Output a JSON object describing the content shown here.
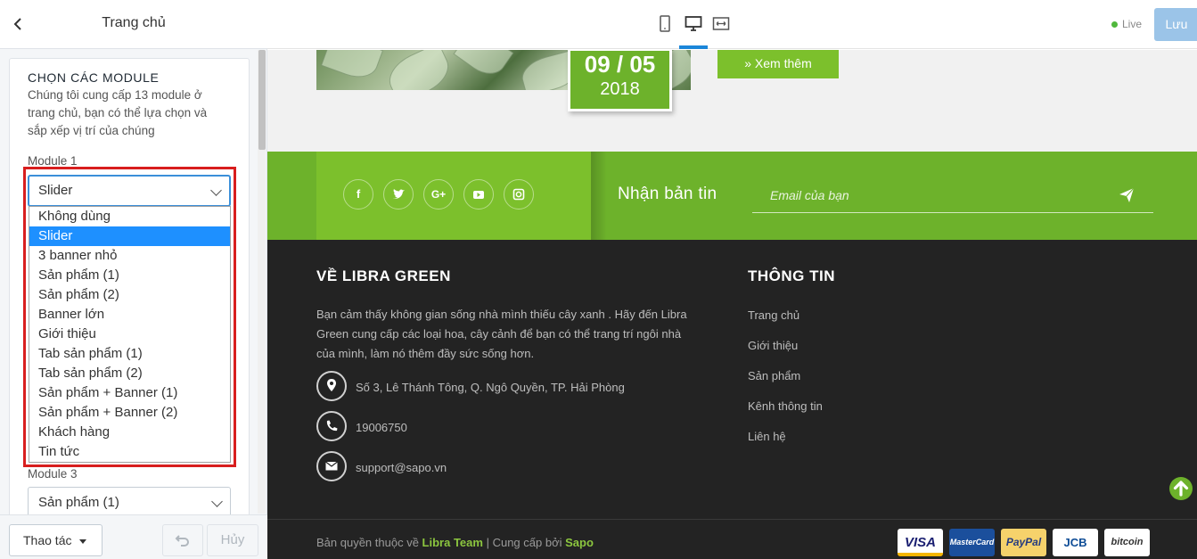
{
  "left_panel": {
    "title": "Trang chủ",
    "section_title": "CHỌN CÁC MODULE",
    "section_desc": "Chúng tôi cung cấp 13 module ở trang chủ, bạn có thể lựa chọn và sắp xếp vị trí của chúng",
    "module1_label": "Module 1",
    "module1_value": "Slider",
    "dropdown_options": [
      "Không dùng",
      "Slider",
      "3 banner nhỏ",
      "Sản phẩm (1)",
      "Sản phẩm (2)",
      "Banner lớn",
      "Giới thiệu",
      "Tab sản phẩm (1)",
      "Tab sản phẩm (2)",
      "Sản phẩm + Banner (1)",
      "Sản phẩm + Banner (2)",
      "Khách hàng",
      "Tin tức"
    ],
    "dropdown_selected": "Slider",
    "module3_label": "Module 3",
    "module3_value": "Sản phẩm (1)",
    "action_button": "Thao tác",
    "cancel_button": "Hủy"
  },
  "topbar": {
    "live_label": "Live",
    "save_button": "Lưu",
    "active_device": "desktop"
  },
  "preview": {
    "date_day": "09 / 05",
    "date_year": "2018",
    "more_button": "» Xem thêm",
    "social_icons": [
      "facebook-icon",
      "twitter-icon",
      "google-plus-icon",
      "youtube-icon",
      "instagram-icon"
    ],
    "newsletter_title": "Nhận bản tin",
    "email_placeholder": "Email của bạn",
    "about_title": "VỀ LIBRA GREEN",
    "about_text": "Bạn cảm thấy không gian sống nhà mình thiếu cây xanh . Hãy đến Libra Green cung cấp các loại hoa, cây cảnh để bạn có thể trang trí ngôi nhà của mình, làm nó thêm đầy sức sống hơn.",
    "address": "Số 3, Lê Thánh Tông, Q. Ngô Quyền, TP. Hải Phòng",
    "phone": "19006750",
    "email": "support@sapo.vn",
    "info_title": "THÔNG TIN",
    "info_links": [
      "Trang chủ",
      "Giới thiệu",
      "Sản phẩm",
      "Kênh thông tin",
      "Liên hệ"
    ],
    "copyright_prefix": "Bản quyền thuộc về",
    "copyright_team": "Libra Team",
    "copyright_sep": "|",
    "copyright_provider_prefix": "Cung cấp bởi",
    "copyright_provider": "Sapo",
    "payment_methods": [
      "VISA",
      "MasterCard",
      "PayPal",
      "JCB",
      "bitcoin"
    ]
  },
  "colors": {
    "accent_green": "#6db22b",
    "highlight_blue": "#1e90ff",
    "annotation_red": "#d81e1e",
    "footer_dark": "#232323"
  }
}
